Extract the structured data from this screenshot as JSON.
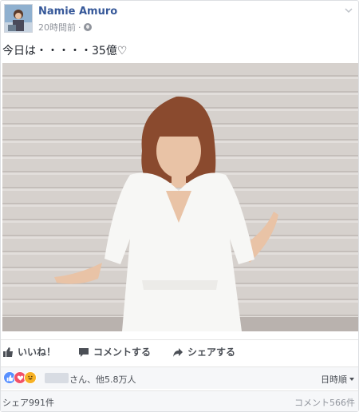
{
  "post": {
    "author": "Namie Amuro",
    "timestamp": "20時間前",
    "separator": "·",
    "text": "今日は・・・・・35億♡"
  },
  "actions": {
    "like": "いいね！",
    "comment": "コメントする",
    "share": "シェアする"
  },
  "reactions": {
    "summary": "さん、他5.8万人",
    "sort": "日時順"
  },
  "footer": {
    "shares": "シェア991件",
    "comments": "コメント566件"
  },
  "colors": {
    "link": "#365899",
    "like": "#5890ff",
    "love": "#f25268",
    "haha": "#f7b125"
  }
}
